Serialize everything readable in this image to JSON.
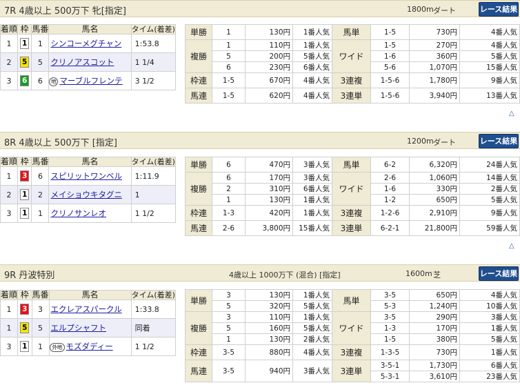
{
  "races": [
    {
      "title": "7R 4歳以上 500万下 牝[指定]",
      "condition": "",
      "distance": "1800m",
      "surface": "ダート",
      "result_button": "レース結果",
      "results": [
        {
          "rank": "1",
          "waku": "1",
          "uma": "1",
          "mark": "",
          "horse": "シンコーメグチャン",
          "time": "1:53.8"
        },
        {
          "rank": "2",
          "waku": "5",
          "uma": "5",
          "mark": "",
          "horse": "クリノアスコット",
          "time": "1 1/4"
        },
        {
          "rank": "3",
          "waku": "6",
          "uma": "6",
          "mark": "地",
          "horse": "マーブルフレンテ",
          "time": "3 1/2"
        }
      ],
      "payouts": {
        "tansho": [
          {
            "n": "1",
            "yen": "130円",
            "pop": "1番人気"
          }
        ],
        "fukusho": [
          {
            "n": "1",
            "yen": "110円",
            "pop": "1番人気"
          },
          {
            "n": "5",
            "yen": "200円",
            "pop": "5番人気"
          },
          {
            "n": "6",
            "yen": "230円",
            "pop": "6番人気"
          }
        ],
        "wakuren": [
          {
            "n": "1-5",
            "yen": "670円",
            "pop": "4番人気"
          }
        ],
        "umaren": [
          {
            "n": "1-5",
            "yen": "620円",
            "pop": "4番人気"
          }
        ],
        "umatan": [
          {
            "n": "1-5",
            "yen": "730円",
            "pop": "4番人気"
          }
        ],
        "wide": [
          {
            "n": "1-5",
            "yen": "270円",
            "pop": "4番人気"
          },
          {
            "n": "1-6",
            "yen": "360円",
            "pop": "5番人気"
          },
          {
            "n": "5-6",
            "yen": "1,070円",
            "pop": "15番人気"
          }
        ],
        "sanrenpuku": [
          {
            "n": "1-5-6",
            "yen": "1,780円",
            "pop": "9番人気"
          }
        ],
        "sanrentan": [
          {
            "n": "1-5-6",
            "yen": "3,940円",
            "pop": "13番人気"
          }
        ]
      }
    },
    {
      "title": "8R 4歳以上 500万下 [指定]",
      "condition": "",
      "distance": "1200m",
      "surface": "ダート",
      "result_button": "レース結果",
      "results": [
        {
          "rank": "1",
          "waku": "3",
          "uma": "6",
          "mark": "",
          "horse": "スピリットワンベル",
          "time": "1:11.9"
        },
        {
          "rank": "2",
          "waku": "1",
          "uma": "2",
          "mark": "",
          "horse": "メイショウキタグニ",
          "time": "1"
        },
        {
          "rank": "3",
          "waku": "1",
          "uma": "1",
          "mark": "",
          "horse": "クリノサンレオ",
          "time": "1 1/2"
        }
      ],
      "payouts": {
        "tansho": [
          {
            "n": "6",
            "yen": "470円",
            "pop": "3番人気"
          }
        ],
        "fukusho": [
          {
            "n": "6",
            "yen": "170円",
            "pop": "3番人気"
          },
          {
            "n": "2",
            "yen": "310円",
            "pop": "6番人気"
          },
          {
            "n": "1",
            "yen": "130円",
            "pop": "1番人気"
          }
        ],
        "wakuren": [
          {
            "n": "1-3",
            "yen": "420円",
            "pop": "1番人気"
          }
        ],
        "umaren": [
          {
            "n": "2-6",
            "yen": "3,800円",
            "pop": "15番人気"
          }
        ],
        "umatan": [
          {
            "n": "6-2",
            "yen": "6,320円",
            "pop": "24番人気"
          }
        ],
        "wide": [
          {
            "n": "2-6",
            "yen": "1,060円",
            "pop": "14番人気"
          },
          {
            "n": "1-6",
            "yen": "330円",
            "pop": "2番人気"
          },
          {
            "n": "1-2",
            "yen": "650円",
            "pop": "5番人気"
          }
        ],
        "sanrenpuku": [
          {
            "n": "1-2-6",
            "yen": "2,910円",
            "pop": "9番人気"
          }
        ],
        "sanrentan": [
          {
            "n": "6-2-1",
            "yen": "21,800円",
            "pop": "59番人気"
          }
        ]
      }
    },
    {
      "title": "9R 丹波特別",
      "condition": "4歳以上 1000万下 (混合) [指定]",
      "distance": "1600m",
      "surface": "芝",
      "result_button": "レース結果",
      "results": [
        {
          "rank": "1",
          "waku": "3",
          "uma": "3",
          "mark": "",
          "horse": "エクレアスパークル",
          "time": "1:33.8"
        },
        {
          "rank": "1",
          "waku": "5",
          "uma": "5",
          "mark": "",
          "horse": "エルプシャフト",
          "time": "同着"
        },
        {
          "rank": "3",
          "waku": "1",
          "uma": "1",
          "mark": "外地",
          "horse": "モズダディー",
          "time": "1 1/2"
        }
      ],
      "payouts": {
        "tansho": [
          {
            "n": "3",
            "yen": "130円",
            "pop": "1番人気"
          },
          {
            "n": "5",
            "yen": "320円",
            "pop": "5番人気"
          }
        ],
        "fukusho": [
          {
            "n": "3",
            "yen": "110円",
            "pop": "1番人気"
          },
          {
            "n": "5",
            "yen": "160円",
            "pop": "5番人気"
          },
          {
            "n": "1",
            "yen": "130円",
            "pop": "2番人気"
          }
        ],
        "wakuren": [
          {
            "n": "3-5",
            "yen": "880円",
            "pop": "4番人気"
          }
        ],
        "umaren": [
          {
            "n": "3-5",
            "yen": "940円",
            "pop": "3番人気"
          }
        ],
        "umatan": [
          {
            "n": "3-5",
            "yen": "650円",
            "pop": "4番人気"
          },
          {
            "n": "5-3",
            "yen": "1,240円",
            "pop": "10番人気"
          }
        ],
        "wide": [
          {
            "n": "3-5",
            "yen": "290円",
            "pop": "3番人気"
          },
          {
            "n": "1-3",
            "yen": "170円",
            "pop": "1番人気"
          },
          {
            "n": "1-5",
            "yen": "380円",
            "pop": "5番人気"
          }
        ],
        "sanrenpuku": [
          {
            "n": "1-3-5",
            "yen": "730円",
            "pop": "1番人気"
          }
        ],
        "sanrentan": [
          {
            "n": "3-5-1",
            "yen": "1,730円",
            "pop": "6番人気"
          },
          {
            "n": "5-3-1",
            "yen": "3,610円",
            "pop": "23番人気"
          }
        ]
      }
    }
  ],
  "labels": {
    "rank": "着順",
    "waku": "枠",
    "uma": "馬番",
    "horse": "馬名",
    "time": "タイム(着差)",
    "tansho": "単勝",
    "fukusho": "複勝",
    "wakuren": "枠連",
    "umaren": "馬連",
    "umatan": "馬単",
    "wide": "ワイド",
    "sanrenpuku": "3連複",
    "sanrentan": "3連単",
    "up": "△"
  },
  "colors": {
    "header_bg": "#f0ebd4",
    "button_bg": "#1f4f8f",
    "link": "#1a1aa0",
    "waku1": "#ffffff",
    "waku3": "#e8101a",
    "waku5": "#f5e600",
    "waku6": "#1a9a2a"
  }
}
